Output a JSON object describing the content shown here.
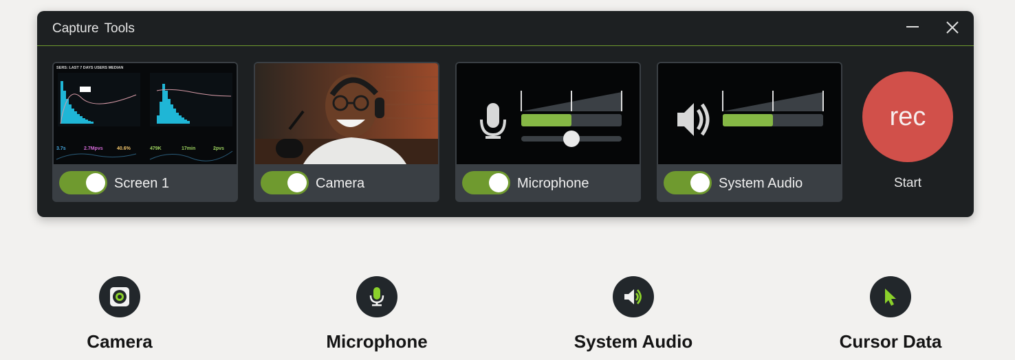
{
  "window": {
    "title": "Capture  Tools",
    "minimize_icon": "minimize-icon",
    "close_icon": "close-icon",
    "accent": "#6f9a2f"
  },
  "cards": [
    {
      "label": "Screen 1",
      "enabled": true
    },
    {
      "label": "Camera",
      "enabled": true
    },
    {
      "label": "Microphone",
      "enabled": true
    },
    {
      "label": "System Audio",
      "enabled": true
    }
  ],
  "screen_preview": {
    "header": "SERS: LAST 7 DAYS USERS MEDIAN",
    "stats": [
      "3.7s",
      "2.7Mpvs",
      "40.6%",
      "479K",
      "17min",
      "2pvs"
    ]
  },
  "microphone": {
    "level": 0.5,
    "volume": 0.5
  },
  "system_audio": {
    "level": 0.5
  },
  "rec": {
    "button": "rec",
    "label": "Start",
    "color": "#d1504a"
  },
  "features": [
    {
      "label": "Camera",
      "icon": "camera-icon"
    },
    {
      "label": "Microphone",
      "icon": "microphone-icon"
    },
    {
      "label": "System Audio",
      "icon": "speaker-icon"
    },
    {
      "label": "Cursor Data",
      "icon": "cursor-icon"
    }
  ]
}
